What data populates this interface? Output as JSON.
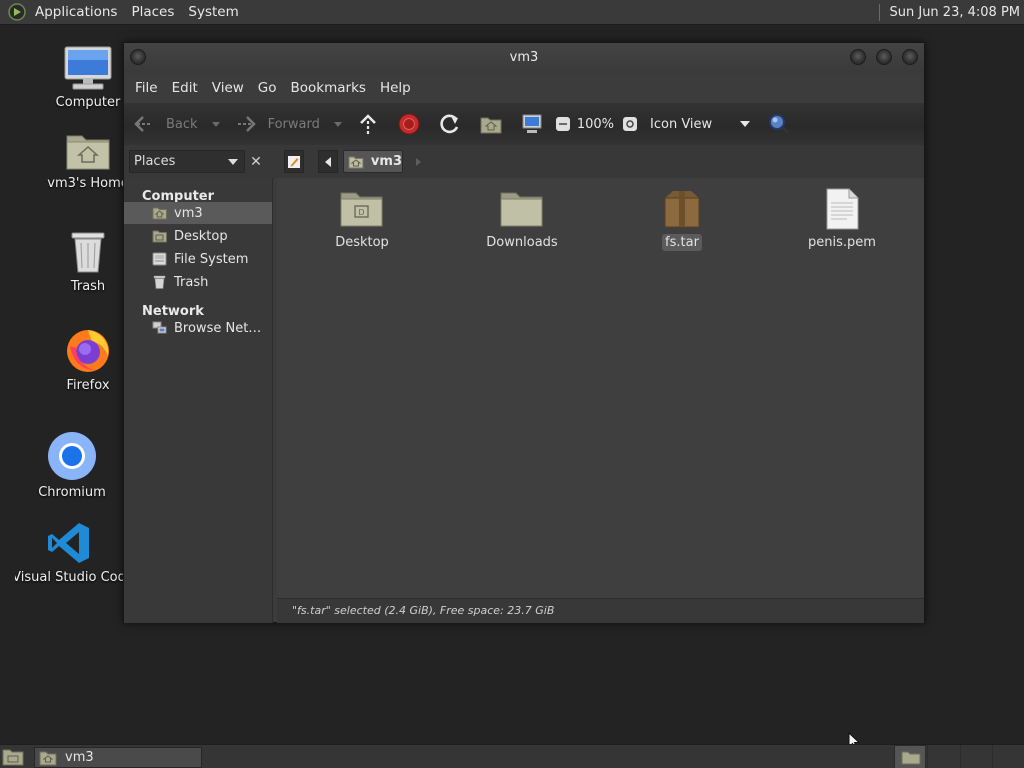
{
  "top_panel": {
    "menus": [
      "Applications",
      "Places",
      "System"
    ],
    "clock": "Sun Jun 23,  4:08 PM"
  },
  "desktop": {
    "icons": [
      {
        "label": "Computer",
        "icon": "computer-icon"
      },
      {
        "label": "vm3's Home",
        "icon": "home-folder-icon"
      },
      {
        "label": "Trash",
        "icon": "trash-icon"
      },
      {
        "label": "Firefox",
        "icon": "firefox-icon"
      },
      {
        "label": "Chromium",
        "icon": "chromium-icon"
      },
      {
        "label": "Visual Studio Cod",
        "icon": "vscode-icon"
      }
    ]
  },
  "window": {
    "title": "vm3",
    "menubar": [
      "File",
      "Edit",
      "View",
      "Go",
      "Bookmarks",
      "Help"
    ],
    "toolbar": {
      "back": "Back",
      "forward": "Forward",
      "zoom": "100%",
      "view_mode": "Icon View"
    },
    "location": {
      "places_label": "Places",
      "path_button": "vm3"
    },
    "sidebar": {
      "computer_header": "Computer",
      "computer_items": [
        {
          "label": "vm3",
          "icon": "home-icon"
        },
        {
          "label": "Desktop",
          "icon": "desktop-icon"
        },
        {
          "label": "File System",
          "icon": "drive-icon"
        },
        {
          "label": "Trash",
          "icon": "trash-icon"
        }
      ],
      "network_header": "Network",
      "network_items": [
        {
          "label": "Browse Net…",
          "icon": "network-icon"
        }
      ]
    },
    "files": [
      {
        "name": "Desktop",
        "type": "folder-desktop"
      },
      {
        "name": "Downloads",
        "type": "folder"
      },
      {
        "name": "fs.tar",
        "type": "archive"
      },
      {
        "name": "penis.pem",
        "type": "text-file"
      }
    ],
    "status": "\"fs.tar\" selected (2.4 GiB), Free space: 23.7 GiB"
  },
  "taskbar": {
    "tasks": [
      "vm3"
    ]
  }
}
